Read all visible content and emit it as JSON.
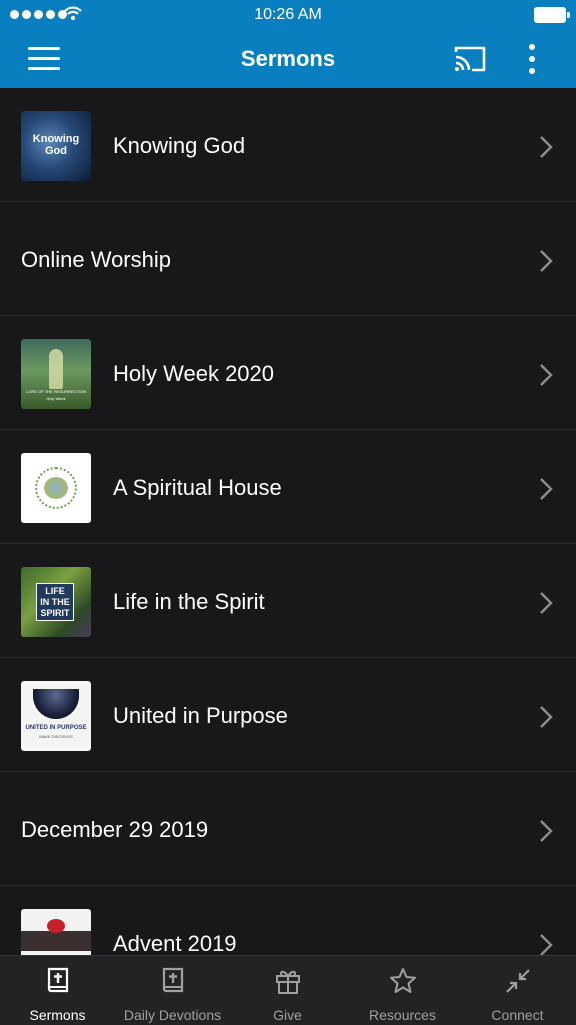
{
  "status_bar": {
    "time": "10:26 AM"
  },
  "header": {
    "title": "Sermons"
  },
  "sermons": [
    {
      "label": "Knowing God",
      "thumb_text": [
        "Knowing",
        "God"
      ]
    },
    {
      "label": "Online Worship"
    },
    {
      "label": "Holy Week 2020",
      "thumb_text": [
        "LORD OF THE RESURRECTION",
        "Holy Week"
      ]
    },
    {
      "label": "A Spiritual House"
    },
    {
      "label": "Life in the Spirit",
      "thumb_text": [
        "LIFE",
        "IN THE",
        "SPIRIT"
      ]
    },
    {
      "label": "United in Purpose",
      "thumb_text": [
        "UNITED IN PURPOSE",
        "MAKE DISCIPLES"
      ]
    },
    {
      "label": "December 29 2019"
    },
    {
      "label": "Advent 2019"
    }
  ],
  "tabs": [
    {
      "label": "Sermons",
      "icon": "bible-icon",
      "active": true
    },
    {
      "label": "Daily Devotions",
      "icon": "bible-icon"
    },
    {
      "label": "Give",
      "icon": "gift-icon"
    },
    {
      "label": "Resources",
      "icon": "star-icon"
    },
    {
      "label": "Connect",
      "icon": "collapse-arrows-icon"
    }
  ],
  "colors": {
    "header": "#0a7fc0",
    "background": "#18181a",
    "tabbar": "#232326"
  }
}
